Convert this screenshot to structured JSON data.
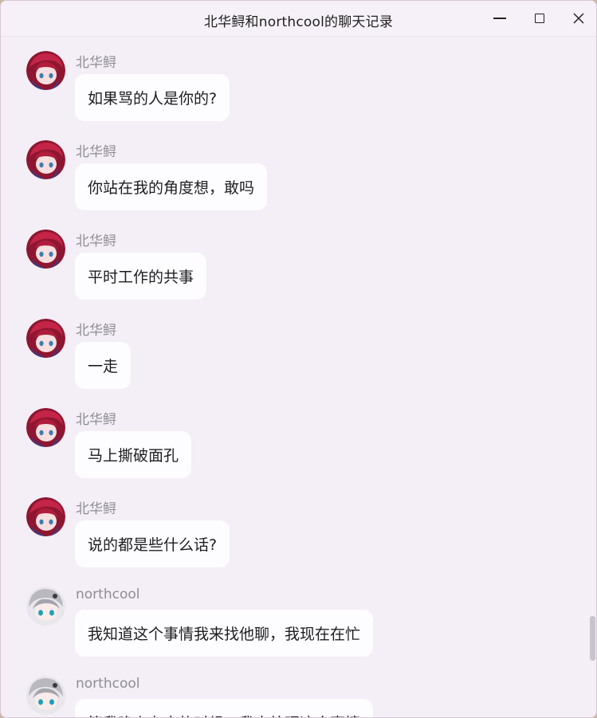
{
  "window": {
    "title": "北华鲟和northcool的聊天记录"
  },
  "messages": [
    {
      "sender": "北华鲟",
      "text": "如果骂的人是你的?",
      "avatar": "red-hair-girl"
    },
    {
      "sender": "北华鲟",
      "text": "你站在我的角度想，敢吗",
      "avatar": "red-hair-girl"
    },
    {
      "sender": "北华鲟",
      "text": "平时工作的共事",
      "avatar": "red-hair-girl"
    },
    {
      "sender": "北华鲟",
      "text": "一走",
      "avatar": "red-hair-girl"
    },
    {
      "sender": "北华鲟",
      "text": "马上撕破面孔",
      "avatar": "red-hair-girl"
    },
    {
      "sender": "北华鲟",
      "text": "说的都是些什么话?",
      "avatar": "red-hair-girl"
    },
    {
      "sender": "northcool",
      "text": "我知道这个事情我来找他聊，我现在在忙",
      "avatar": "silver-hair-girl"
    },
    {
      "sender": "northcool",
      "text": "等我晚上有空的时候，我来处理这个事情",
      "avatar": "silver-hair-girl"
    }
  ],
  "colors": {
    "window_bg": "#f4eef7",
    "bubble_bg": "#fdfcfe",
    "sender_text": "#8e8e94",
    "message_text": "#1d1d1f"
  },
  "icons": {
    "minimize": "minimize-icon",
    "maximize": "maximize-icon",
    "close": "close-icon"
  }
}
